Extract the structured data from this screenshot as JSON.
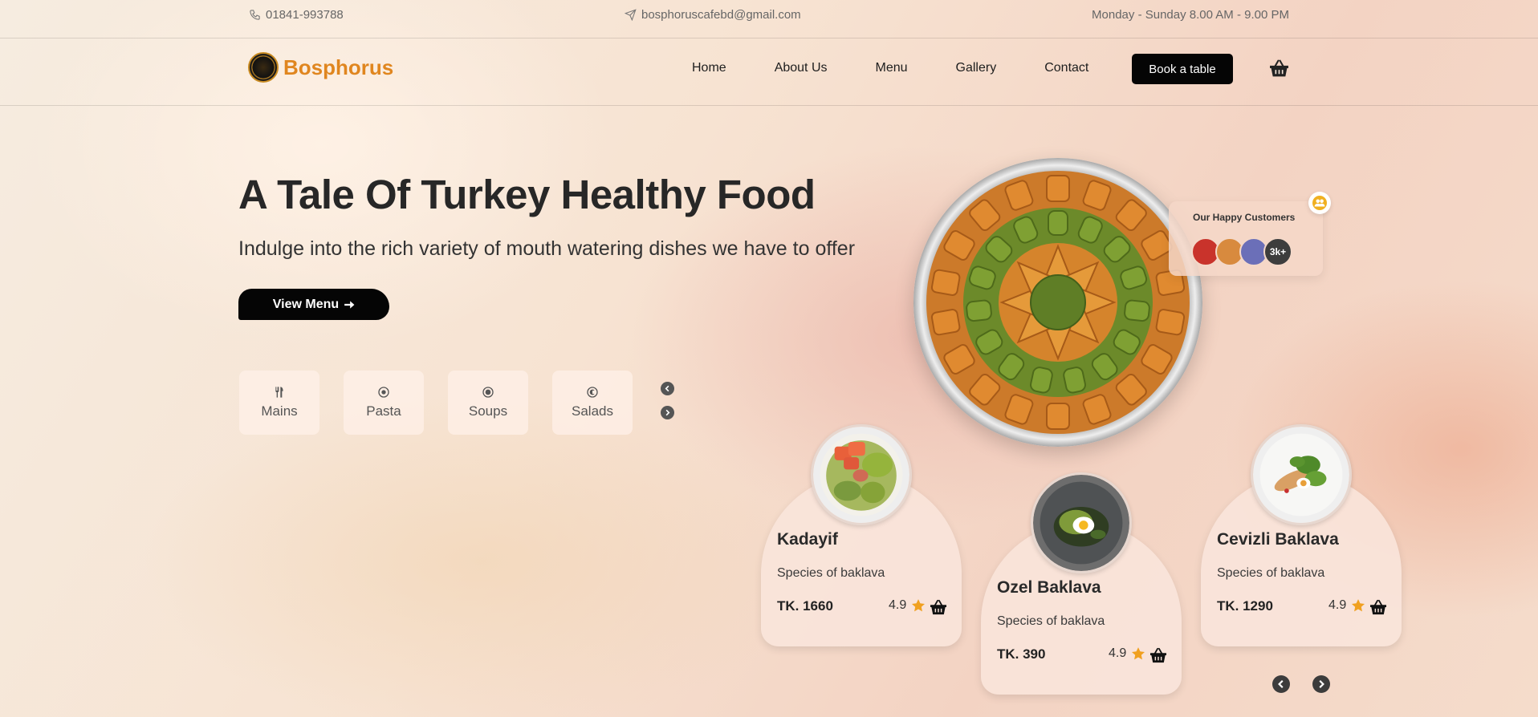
{
  "topbar": {
    "phone": "01841-993788",
    "email": "bosphoruscafebd@gmail.com",
    "hours": "Monday - Sunday 8.00 AM - 9.00 PM"
  },
  "brand": {
    "name": "Bosphorus"
  },
  "nav": {
    "items": [
      "Home",
      "About Us",
      "Menu",
      "Gallery",
      "Contact"
    ],
    "book_label": "Book a table"
  },
  "hero": {
    "title": "A Tale Of Turkey Healthy Food",
    "subtitle": "Indulge into the rich variety of mouth watering dishes we have to offer",
    "cta_label": "View Menu"
  },
  "categories": [
    "Mains",
    "Pasta",
    "Soups",
    "Salads"
  ],
  "happy_customers": {
    "title": "Our Happy Customers",
    "count_label": "3k+"
  },
  "products": [
    {
      "name": "Kadayif",
      "description": "Species of baklava",
      "price": "TK. 1660",
      "rating": "4.9"
    },
    {
      "name": "Ozel Baklava",
      "description": "Species of baklava",
      "price": "TK. 390",
      "rating": "4.9"
    },
    {
      "name": "Cevizli Baklava",
      "description": "Species of baklava",
      "price": "TK. 1290",
      "rating": "4.9"
    }
  ],
  "colors": {
    "brand": "#e0861f",
    "button": "#050505",
    "star": "#f0a020",
    "card_bg": "#fae4da"
  },
  "icons": {
    "phone": "phone-icon",
    "email": "send-icon",
    "cart": "basket-icon",
    "star": "star-icon",
    "customers": "users-icon"
  }
}
